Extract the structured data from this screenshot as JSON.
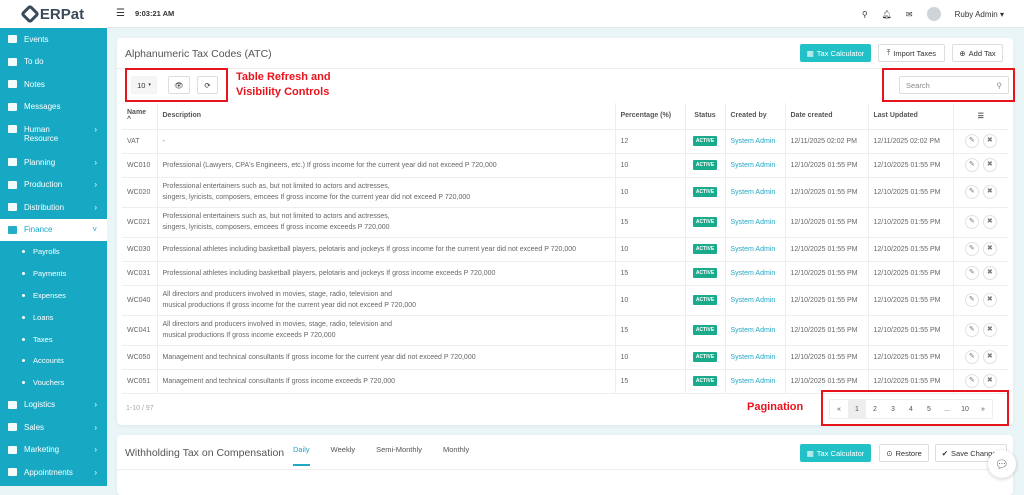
{
  "app": {
    "logo": "ERPat",
    "time": "9:03:21 AM",
    "user": "Ruby Admin"
  },
  "sidebar": {
    "items": [
      {
        "label": "Events"
      },
      {
        "label": "To do"
      },
      {
        "label": "Notes"
      },
      {
        "label": "Messages"
      },
      {
        "label": "Human Resource"
      },
      {
        "label": "Planning"
      },
      {
        "label": "Production"
      },
      {
        "label": "Distribution"
      },
      {
        "label": "Finance"
      }
    ],
    "finance_sub": [
      "Payrolls",
      "Payments",
      "Expenses",
      "Loans",
      "Taxes",
      "Accounts",
      "Vouchers"
    ],
    "after": [
      {
        "label": "Logistics"
      },
      {
        "label": "Sales"
      },
      {
        "label": "Marketing"
      },
      {
        "label": "Appointments"
      }
    ]
  },
  "atc": {
    "title": "Alphanumeric Tax Codes (ATC)",
    "tax_calc": "Tax Calculator",
    "import": "Import Taxes",
    "add": "Add Tax",
    "page_size": "10",
    "search_placeholder": "Search",
    "columns": [
      "Name ^",
      "Description",
      "Percentage (%)",
      "Status",
      "Created by",
      "Date created",
      "Last Updated"
    ],
    "rows": [
      {
        "name": "VAT",
        "desc": "-",
        "pct": "12",
        "status": "ACTIVE",
        "by": "System Admin",
        "created": "12/11/2025 02:02 PM",
        "updated": "12/11/2025 02:02 PM"
      },
      {
        "name": "WC010",
        "desc": "Professional (Lawyers, CPA's Engineers, etc.) If gross income for the current year did not exceed P 720,000",
        "pct": "10",
        "status": "ACTIVE",
        "by": "System Admin",
        "created": "12/10/2025 01:55 PM",
        "updated": "12/10/2025 01:55 PM"
      },
      {
        "name": "WC020",
        "desc": "Professional entertainers such as, but not limited to actors and actresses,\nsingers, lyricists, composers, emcees If gross income for the current year did not exceed P 720,000",
        "pct": "10",
        "status": "ACTIVE",
        "by": "System Admin",
        "created": "12/10/2025 01:55 PM",
        "updated": "12/10/2025 01:55 PM"
      },
      {
        "name": "WC021",
        "desc": "Professional entertainers such as, but not limited to actors and actresses,\nsingers, lyricists, composers, emcees If gross income exceeds P 720,000",
        "pct": "15",
        "status": "ACTIVE",
        "by": "System Admin",
        "created": "12/10/2025 01:55 PM",
        "updated": "12/10/2025 01:55 PM"
      },
      {
        "name": "WC030",
        "desc": "Professional athletes including basketball players, pelotaris and jockeys If gross income for the current year did not exceed P 720,000",
        "pct": "10",
        "status": "ACTIVE",
        "by": "System Admin",
        "created": "12/10/2025 01:55 PM",
        "updated": "12/10/2025 01:55 PM"
      },
      {
        "name": "WC031",
        "desc": "Professional athletes including basketball players, pelotaris and jockeys If gross income exceeds P 720,000",
        "pct": "15",
        "status": "ACTIVE",
        "by": "System Admin",
        "created": "12/10/2025 01:55 PM",
        "updated": "12/10/2025 01:55 PM"
      },
      {
        "name": "WC040",
        "desc": "All directors and producers involved in movies, stage, radio, television and\nmusical productions If gross income for the current year did not exceed P 720,000",
        "pct": "10",
        "status": "ACTIVE",
        "by": "System Admin",
        "created": "12/10/2025 01:55 PM",
        "updated": "12/10/2025 01:55 PM"
      },
      {
        "name": "WC041",
        "desc": "All directors and producers involved in movies, stage, radio, television and\nmusical productions If gross income exceeds P 720,000",
        "pct": "15",
        "status": "ACTIVE",
        "by": "System Admin",
        "created": "12/10/2025 01:55 PM",
        "updated": "12/10/2025 01:55 PM"
      },
      {
        "name": "WC050",
        "desc": "Management and technical consultants If gross income for the current year did not exceed P 720,000",
        "pct": "10",
        "status": "ACTIVE",
        "by": "System Admin",
        "created": "12/10/2025 01:55 PM",
        "updated": "12/10/2025 01:55 PM"
      },
      {
        "name": "WC051",
        "desc": "Management and technical consultants If gross income exceeds P 720,000",
        "pct": "15",
        "status": "ACTIVE",
        "by": "System Admin",
        "created": "12/10/2025 01:55 PM",
        "updated": "12/10/2025 01:55 PM"
      }
    ],
    "range": "1-10 / 97",
    "pages": [
      "«",
      "1",
      "2",
      "3",
      "4",
      "5",
      "...",
      "10",
      "»"
    ]
  },
  "annotations": {
    "controls": "Table Refresh and\nVisibility Controls",
    "pagination": "Pagination"
  },
  "wtc": {
    "title": "Withholding Tax on Compensation",
    "tabs": [
      "Daily",
      "Weekly",
      "Semi-Monthly",
      "Monthly"
    ],
    "tax_calc": "Tax Calculator",
    "restore": "Restore",
    "save": "Save Changes"
  }
}
